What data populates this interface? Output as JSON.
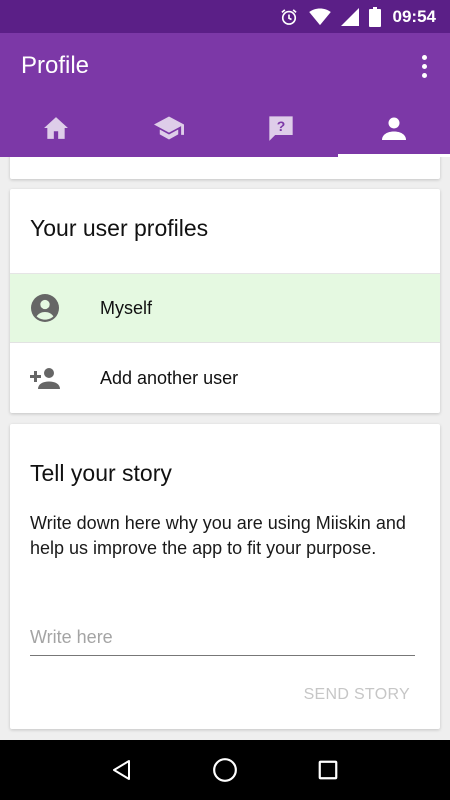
{
  "status_bar": {
    "time": "09:54",
    "icons": [
      "alarm-icon",
      "wifi-icon",
      "signal-icon",
      "battery-icon"
    ]
  },
  "app_bar": {
    "title": "Profile",
    "menu_icon": "more-vert-icon",
    "background_color": "#7c38a7",
    "status_color": "#5b1f87"
  },
  "tabs": [
    {
      "icon": "home-icon",
      "active": false
    },
    {
      "icon": "school-icon",
      "active": false
    },
    {
      "icon": "help-icon",
      "active": false
    },
    {
      "icon": "person-icon",
      "active": true
    }
  ],
  "profiles_card": {
    "title": "Your user profiles",
    "items": [
      {
        "label": "Myself",
        "icon": "account-circle-icon",
        "selected": true
      },
      {
        "label": "Add another user",
        "icon": "person-add-icon",
        "selected": false
      }
    ],
    "selected_color": "#e5f9e1"
  },
  "story_card": {
    "title": "Tell your story",
    "description": "Write down here why you are using Miiskin and help us improve the app to fit your purpose.",
    "input_value": "",
    "input_placeholder": "Write here",
    "send_label": "SEND STORY"
  },
  "nav_bar": {
    "icons": [
      "back-icon",
      "home-circle-icon",
      "recents-icon"
    ]
  }
}
